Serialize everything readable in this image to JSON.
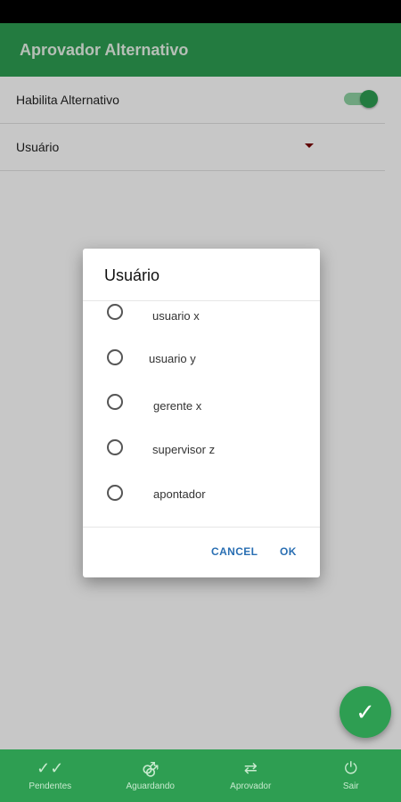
{
  "colors": {
    "primary": "#2e9e52",
    "accent_toggle_track": "#8fd3a3",
    "dialog_button": "#2a6fb3"
  },
  "appbar": {
    "title": "Aprovador Alternativo"
  },
  "settings": {
    "toggle_label": "Habilita Alternativo",
    "toggle_on": true,
    "user_label": "Usuário"
  },
  "dialog": {
    "title": "Usuário",
    "options": [
      "usuario x",
      "usuario y",
      "gerente x",
      "supervisor z",
      "apontador"
    ],
    "cancel_label": "CANCEL",
    "ok_label": "OK"
  },
  "fab": {
    "icon": "check-icon"
  },
  "bottom_nav": [
    {
      "label": "Pendentes",
      "icon": "double-check-icon"
    },
    {
      "label": "Aguardando",
      "icon": "person-icon"
    },
    {
      "label": "Aprovador",
      "icon": "swap-icon"
    },
    {
      "label": "Sair",
      "icon": "power-icon"
    }
  ]
}
